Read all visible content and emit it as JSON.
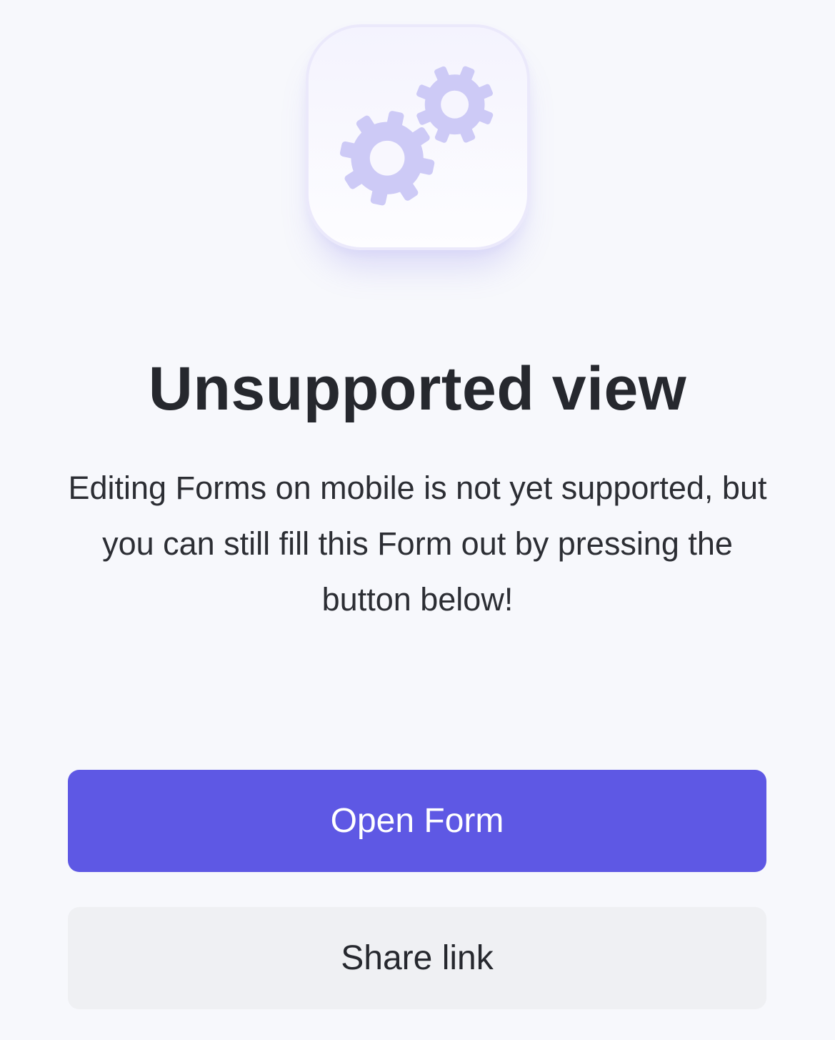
{
  "app": {
    "icon": "gears-icon",
    "colors": {
      "background": "#f7f8fc",
      "accent": "#5e58e4",
      "gear": "#cdcaf6",
      "secondary_button": "#eff0f3",
      "text": "#26282e"
    }
  },
  "message": {
    "title": "Unsupported view",
    "description": "Editing Forms on mobile is not yet supported, but you can still fill this Form out by pressing the button below!"
  },
  "actions": {
    "open_form_label": "Open Form",
    "share_link_label": "Share link"
  }
}
